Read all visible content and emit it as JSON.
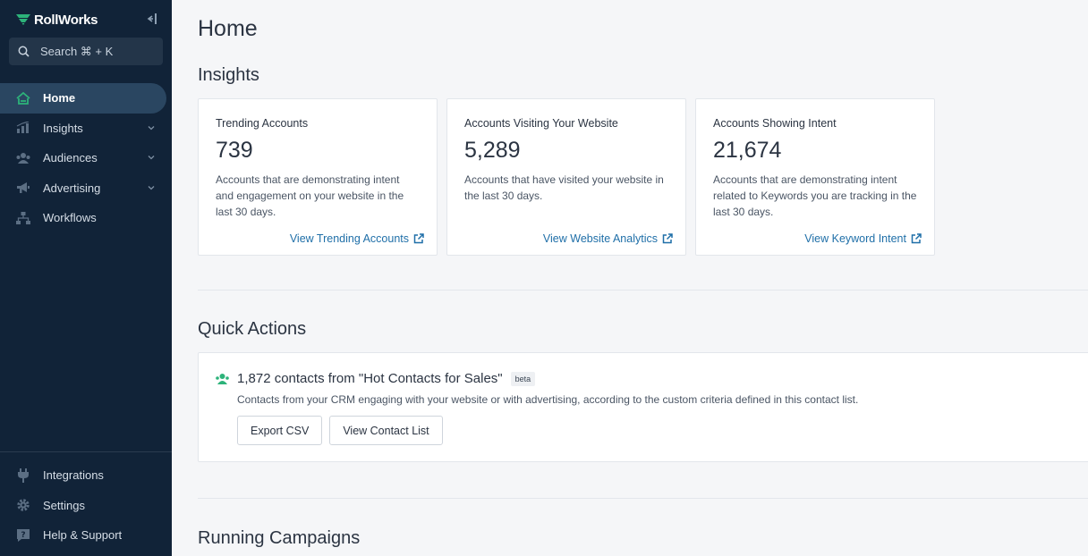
{
  "sidebar": {
    "logo_text": "RollWorks",
    "search_placeholder": "Search ⌘ + K",
    "items": [
      {
        "label": "Home",
        "icon": "home-icon"
      },
      {
        "label": "Insights",
        "icon": "insights-icon"
      },
      {
        "label": "Audiences",
        "icon": "audiences-icon"
      },
      {
        "label": "Advertising",
        "icon": "megaphone-icon"
      },
      {
        "label": "Workflows",
        "icon": "workflows-icon"
      }
    ],
    "bottom_items": [
      {
        "label": "Integrations",
        "icon": "plug-icon"
      },
      {
        "label": "Settings",
        "icon": "gear-icon"
      },
      {
        "label": "Help & Support",
        "icon": "help-icon"
      }
    ]
  },
  "main": {
    "page_title": "Home",
    "insights_title": "Insights",
    "cards": [
      {
        "title": "Trending Accounts",
        "value": "739",
        "description": "Accounts that are demonstrating intent and engagement on your website in the last 30 days.",
        "link": "View Trending Accounts"
      },
      {
        "title": "Accounts Visiting Your Website",
        "value": "5,289",
        "description": "Accounts that have visited your website in the last 30 days.",
        "link": "View Website Analytics"
      },
      {
        "title": "Accounts Showing Intent",
        "value": "21,674",
        "description": "Accounts that are demonstrating intent related to Keywords you are tracking in the last 30 days.",
        "link": "View Keyword Intent"
      }
    ],
    "quick_actions_title": "Quick Actions",
    "quick_action": {
      "title": "1,872 contacts from \"Hot Contacts for Sales\"",
      "badge": "beta",
      "description": "Contacts from your CRM engaging with your website or with advertising, according to the custom criteria defined in this contact list.",
      "export_label": "Export CSV",
      "view_label": "View Contact List"
    },
    "running_campaigns_title": "Running Campaigns"
  },
  "colors": {
    "sidebar_bg": "#112338",
    "accent": "#1f6fa8",
    "brand_green": "#2db37a"
  }
}
